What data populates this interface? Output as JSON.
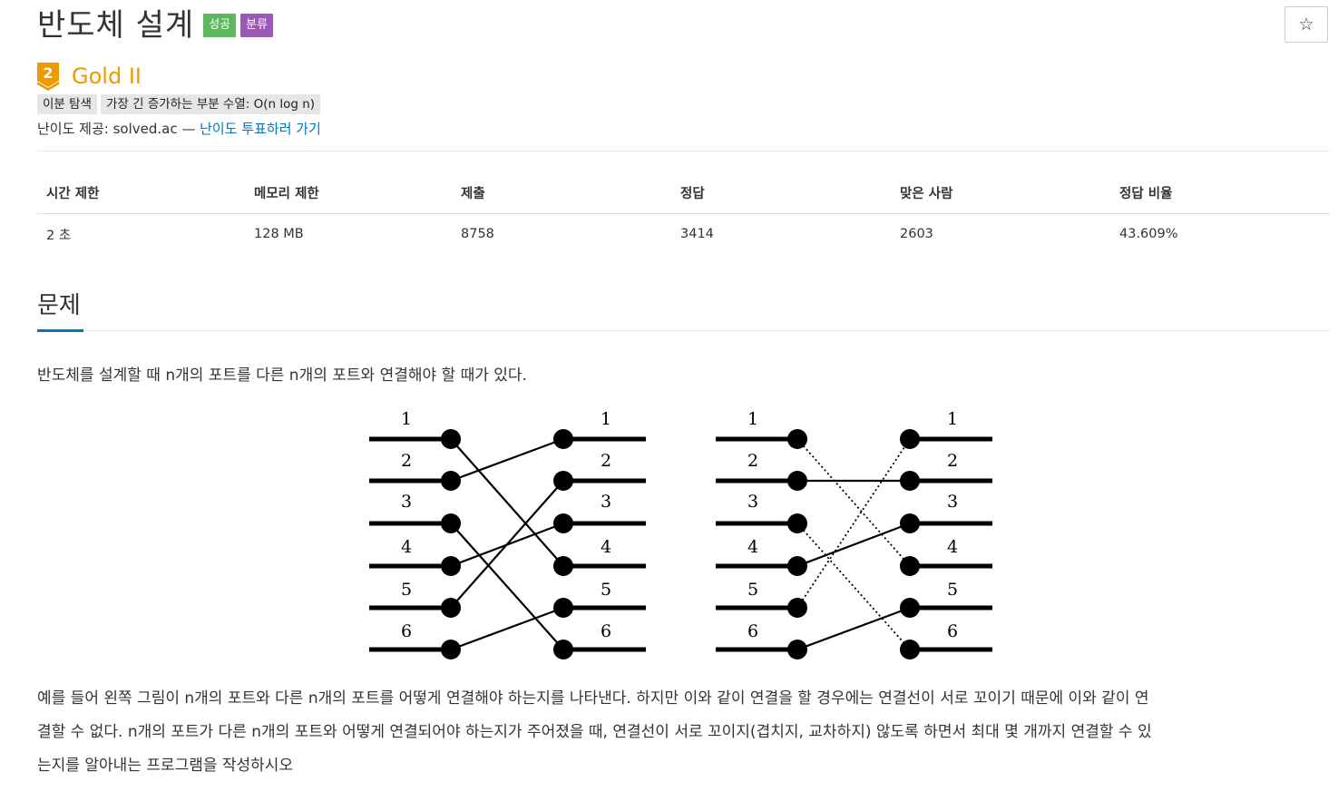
{
  "problem": {
    "title": "반도체 설계",
    "labels": {
      "success": "성공",
      "category": "분류"
    },
    "star_icon": "☆",
    "tier": {
      "number": "2",
      "name": "Gold II",
      "color": "#ec9a00"
    },
    "tags": [
      "이분 탐색",
      "가장 긴 증가하는 부분 수열: O(n log n)"
    ],
    "difficulty": {
      "prefix": "난이도 제공: solved.ac — ",
      "link": "난이도 투표하러 가기"
    }
  },
  "stats": {
    "headers": [
      "시간 제한",
      "메모리 제한",
      "제출",
      "정답",
      "맞은 사람",
      "정답 비율"
    ],
    "values": [
      "2 초",
      "128 MB",
      "8758",
      "3414",
      "2603",
      "43.609%"
    ]
  },
  "section": {
    "title": "문제"
  },
  "description": {
    "intro": "반도체를 설계할 때 n개의 포트를 다른 n개의 포트와 연결해야 할 때가 있다.",
    "line1": "예를 들어 왼쪽 그림이 n개의 포트와 다른 n개의 포트를 어떻게 연결해야 하는지를 나타낸다. 하지만 이와 같이 연결을 할 경우에는 연결선이 서로 꼬이기 때문에 이와 같이 연",
    "line2": "결할 수 없다. n개의 포트가 다른 n개의 포트와 어떻게 연결되어야 하는지가 주어졌을 때, 연결선이 서로 꼬이지(겹치지, 교차하지) 않도록 하면서 최대 몇 개까지 연결할 수 있",
    "line3": "는지를 알아내는 프로그램을 작성하시오"
  },
  "figure": {
    "port_labels": [
      "1",
      "2",
      "3",
      "4",
      "5",
      "6"
    ],
    "connections": [
      4,
      1,
      4,
      6,
      2,
      5,
      1,
      3,
      6,
      2,
      5
    ],
    "left_mapping": [
      [
        1,
        4
      ],
      [
        2,
        1
      ],
      [
        3,
        6
      ],
      [
        4,
        3
      ],
      [
        5,
        2
      ],
      [
        6,
        5
      ]
    ],
    "right_solid": [
      [
        2,
        2
      ],
      [
        4,
        3
      ],
      [
        6,
        5
      ]
    ],
    "right_dotted": [
      [
        1,
        4
      ],
      [
        3,
        6
      ],
      [
        5,
        1
      ]
    ]
  }
}
